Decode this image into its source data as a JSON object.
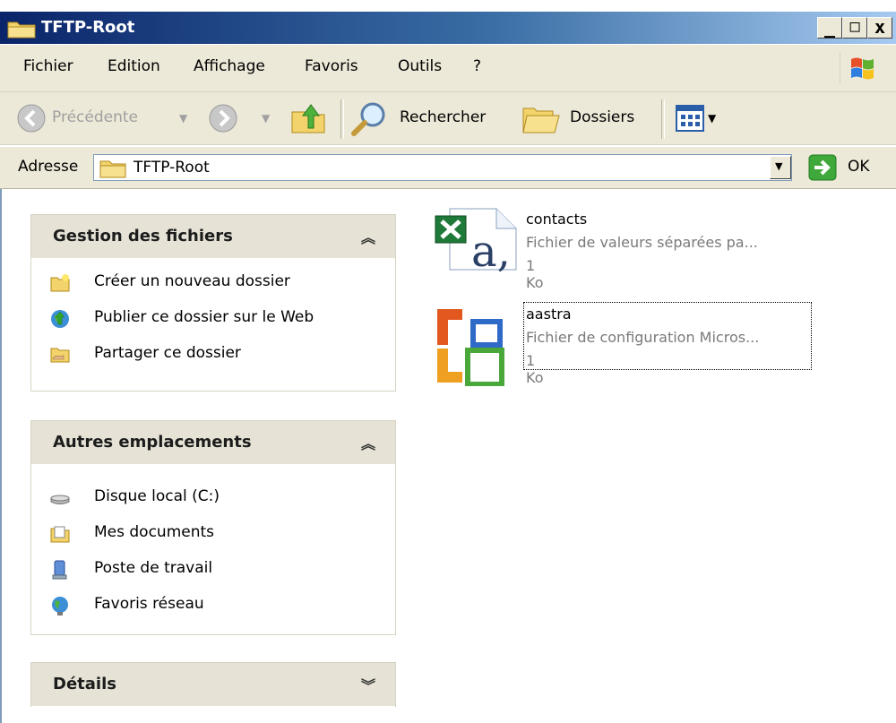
{
  "window": {
    "title": "TFTP-Root",
    "min": "_",
    "max": "□",
    "close": "x"
  },
  "menu": [
    "Fichier",
    "Edition",
    "Affichage",
    "Favoris",
    "Outils",
    "?"
  ],
  "toolbar": {
    "back": "Précédente",
    "search": "Rechercher",
    "folders": "Dossiers"
  },
  "address": {
    "label": "Adresse",
    "value": "TFTP-Root",
    "go": "OK"
  },
  "panels": {
    "file_tasks": {
      "title": "Gestion des fichiers",
      "items": [
        "Créer un nouveau dossier",
        "Publier ce dossier sur le Web",
        "Partager ce dossier"
      ]
    },
    "other_places": {
      "title": "Autres emplacements",
      "items": [
        "Disque local (C:)",
        "Mes documents",
        "Poste de travail",
        "Favoris réseau"
      ]
    },
    "details": {
      "title": "Détails"
    }
  },
  "files": [
    {
      "name": "contacts",
      "type": "Fichier de valeurs séparées pa...",
      "size": "1 Ko",
      "icon": "excel-csv-icon"
    },
    {
      "name": "aastra",
      "type": "Fichier de configuration Micros...",
      "size": "1 Ko",
      "icon": "office-config-icon"
    }
  ],
  "colors": {
    "title_start": "#0a246a",
    "title_end": "#a6caf0",
    "chrome": "#ece9d8",
    "panel_head": "#e6e3d6"
  }
}
